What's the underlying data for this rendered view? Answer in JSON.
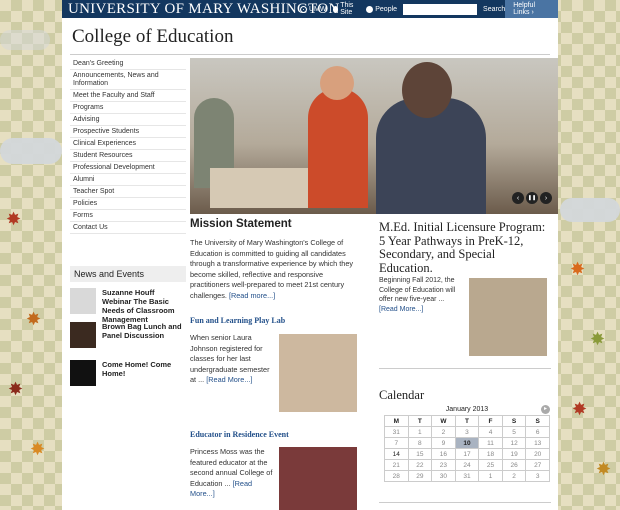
{
  "topbar": {
    "brand": "UNIVERSITY OF MARY WASHINGTON",
    "radios": [
      {
        "label": "UMW",
        "checked": true
      },
      {
        "label": "This Site",
        "checked": false
      },
      {
        "label": "People",
        "checked": false
      }
    ],
    "search_placeholder": "",
    "search_label": "Search",
    "helpful_links_label": "Helpful Links ›"
  },
  "page_title": "College of Education",
  "nav": [
    "Dean's Greeting",
    "Announcements, News and Information",
    "Meet the Faculty and Staff",
    "Programs",
    "Advising",
    "Prospective Students",
    "Clinical Experiences",
    "Student Resources",
    "Professional Development",
    "Alumni",
    "Teacher Spot",
    "Policies",
    "Forms",
    "Contact Us"
  ],
  "news": {
    "heading": "News and Events",
    "items": [
      {
        "title": "Suzanne Houff Webinar The Basic Needs of Classroom Management"
      },
      {
        "title": "Brown Bag Lunch and Panel Discussion"
      },
      {
        "title": "Come Home! Come Home!"
      }
    ]
  },
  "slideshow": {
    "prev_icon": "‹",
    "pause_icon": "❚❚",
    "next_icon": "›"
  },
  "mission": {
    "heading": "Mission Statement",
    "text": "The University of Mary Washington's College of Education is committed to guiding all candidates through a transformative experience by which they become skilled, reflective and responsive practitioners well-prepared to meet 21st century challenges.",
    "more": "[Read more...]"
  },
  "stories": [
    {
      "heading": "Fun and Learning Play Lab",
      "text": "When senior Laura Johnson registered for classes for her last undergraduate semester at ...",
      "more": "[Read More...]"
    },
    {
      "heading": "Educator in Residence Event",
      "text": "Princess Moss was the featured educator at the second annual College of Education ...",
      "more": "[Read More...]"
    }
  ],
  "med": {
    "heading": "M.Ed. Initial Licensure Program: 5 Year Pathways in PreK-12, Secondary, and Special Education.",
    "text": "Beginning Fall 2012, the College of Education will offer new five-year ...",
    "more": "[Read More...]"
  },
  "calendar": {
    "heading": "Calendar",
    "month": "January 2013",
    "next_icon": "▸",
    "days": [
      "M",
      "T",
      "W",
      "T",
      "F",
      "S",
      "S"
    ],
    "weeks": [
      [
        "31",
        "1",
        "2",
        "3",
        "4",
        "5",
        "6"
      ],
      [
        "7",
        "8",
        "9",
        "10",
        "11",
        "12",
        "13"
      ],
      [
        "14",
        "15",
        "16",
        "17",
        "18",
        "19",
        "20"
      ],
      [
        "21",
        "22",
        "23",
        "24",
        "25",
        "26",
        "27"
      ],
      [
        "28",
        "29",
        "30",
        "31",
        "1",
        "2",
        "3"
      ]
    ],
    "today": "10"
  }
}
